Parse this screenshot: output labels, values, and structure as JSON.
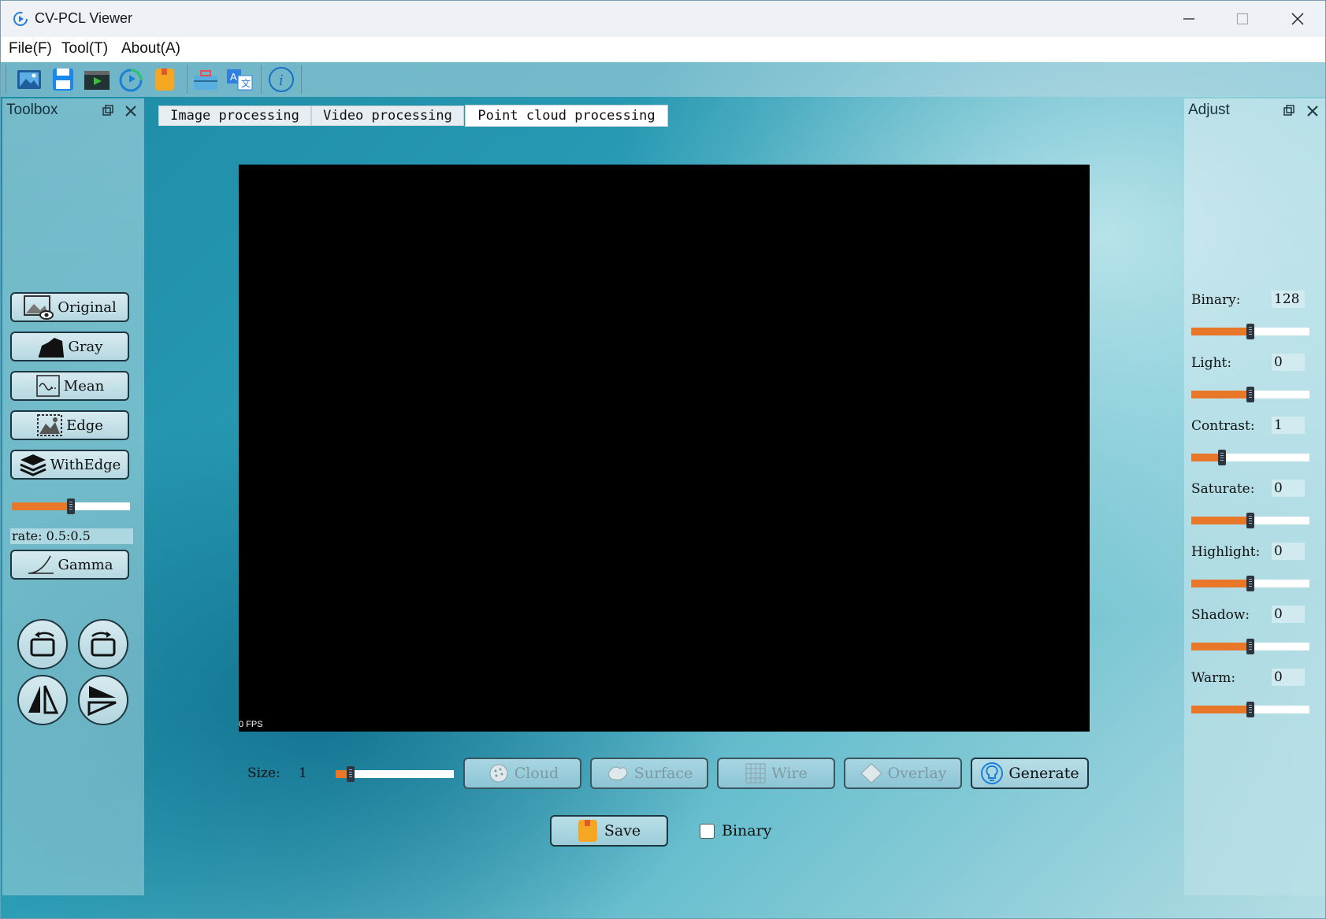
{
  "window": {
    "title": "CV-PCL Viewer"
  },
  "menu": [
    "File(F)",
    "Tool(T)",
    "About(A)"
  ],
  "toolbar": {
    "icons": [
      "open-image-icon",
      "save-icon",
      "video-icon",
      "refresh-icon",
      "bookmark-icon",
      "toolbox-icon",
      "translate-icon",
      "info-icon"
    ]
  },
  "toolbox": {
    "title": "Toolbox",
    "buttons": {
      "original": "Original",
      "gray": "Gray",
      "mean": "Mean",
      "edge": "Edge",
      "withedge": "WithEdge",
      "gamma": "Gamma"
    },
    "rate_label": "rate: 0.5:0.5",
    "rate_slider": 0.5
  },
  "tabs": [
    "Image processing",
    "Video processing",
    "Point cloud processing"
  ],
  "active_tab": "Point cloud processing",
  "viewport": {
    "fps": "0 FPS"
  },
  "pointcloud": {
    "size_label": "Size:",
    "size_value": "1",
    "size_slider": 0.1,
    "buttons": {
      "cloud": "Cloud",
      "surface": "Surface",
      "wire": "Wire",
      "overlay": "Overlay",
      "generate": "Generate"
    },
    "save": "Save",
    "binary_checkbox": "Binary",
    "binary_checked": false
  },
  "adjust": {
    "title": "Adjust",
    "items": [
      {
        "label": "Binary:",
        "value": "128",
        "level": 0.5
      },
      {
        "label": "Light:",
        "value": "0",
        "level": 0.5
      },
      {
        "label": "Contrast:",
        "value": "1",
        "level": 0.26
      },
      {
        "label": "Saturate:",
        "value": "0",
        "level": 0.5
      },
      {
        "label": "Highlight:",
        "value": "0",
        "level": 0.5
      },
      {
        "label": "Shadow:",
        "value": "0",
        "level": 0.5
      },
      {
        "label": "Warm:",
        "value": "0",
        "level": 0.5
      }
    ]
  },
  "colors": {
    "slider_fill": "#e8772a",
    "accent": "#1e3640"
  }
}
